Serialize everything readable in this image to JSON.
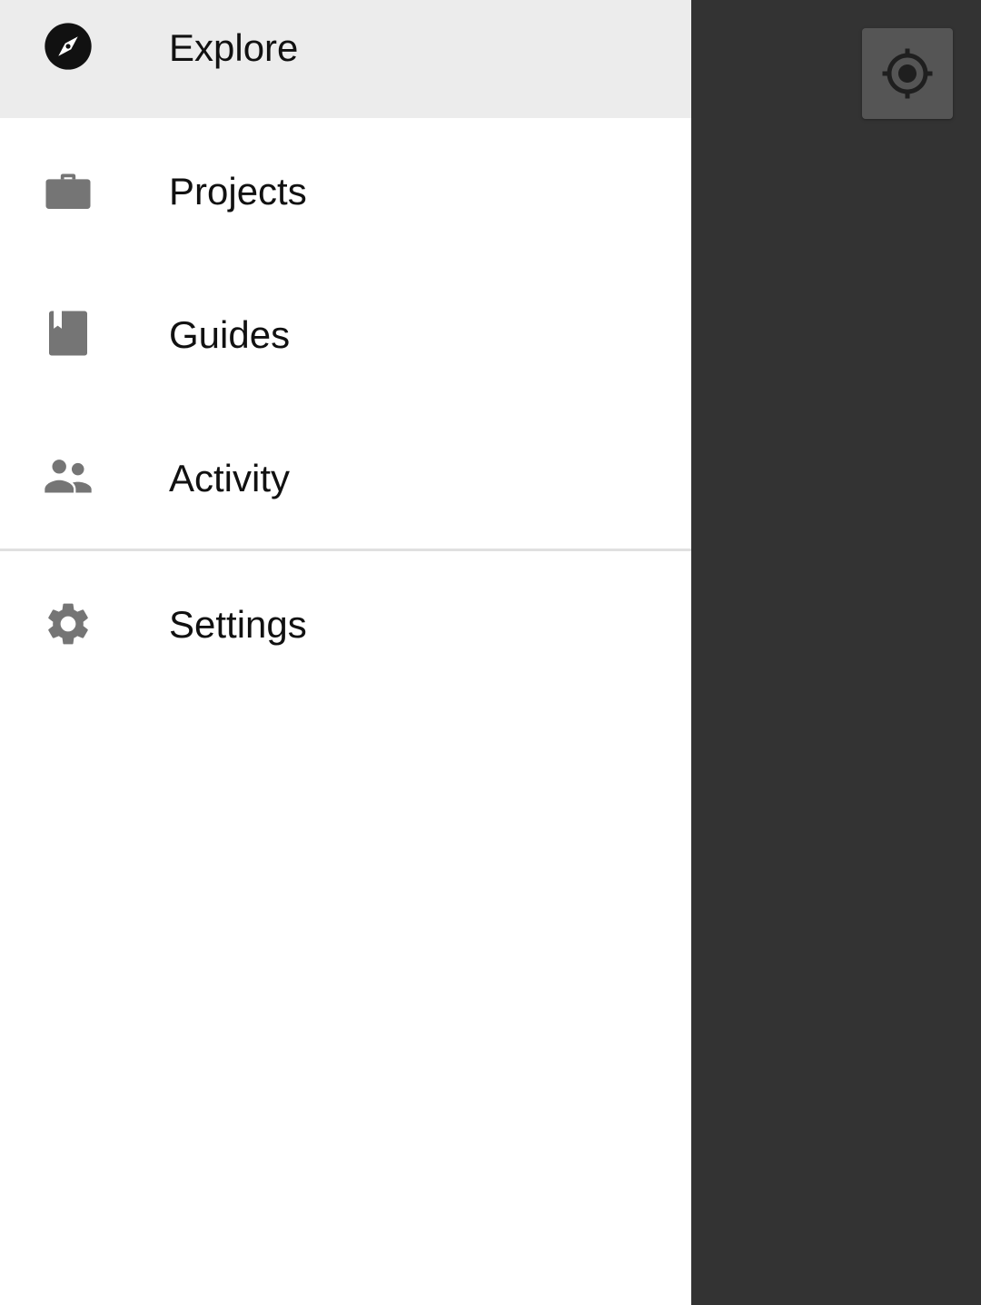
{
  "drawer": {
    "items": [
      {
        "label": "Explore",
        "icon": "compass-icon",
        "active": true
      },
      {
        "label": "Projects",
        "icon": "briefcase-icon",
        "active": false
      },
      {
        "label": "Guides",
        "icon": "book-icon",
        "active": false
      },
      {
        "label": "Activity",
        "icon": "people-icon",
        "active": false
      },
      {
        "label": "Settings",
        "icon": "gear-icon",
        "active": false
      }
    ]
  },
  "map_controls": {
    "my_location_icon": "my-location-icon"
  },
  "colors": {
    "scrim": "#333333",
    "active_item_bg": "#ececec",
    "icon_gray": "#757575",
    "icon_active": "#111111",
    "location_button_bg": "#555555"
  }
}
